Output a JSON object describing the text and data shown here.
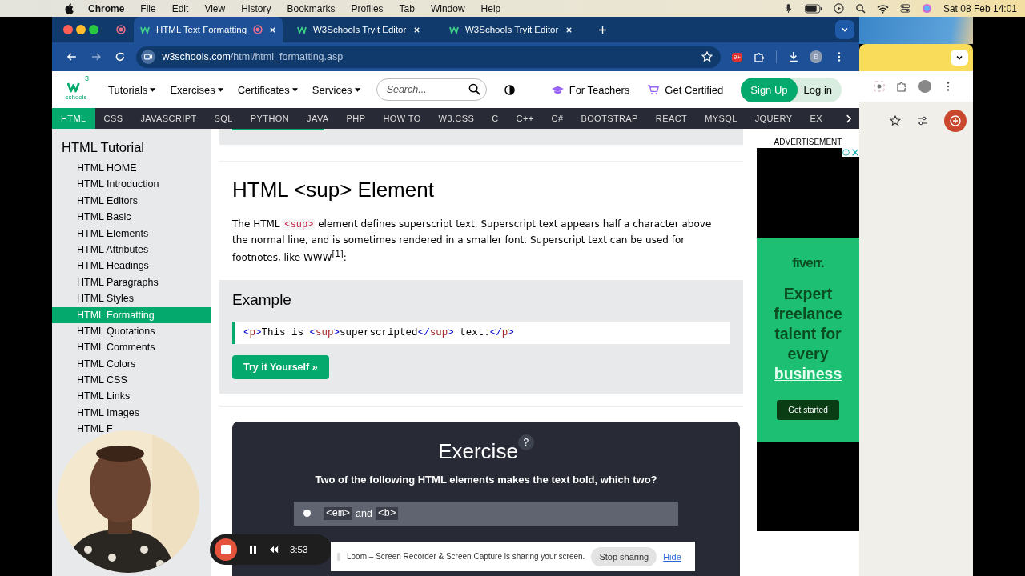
{
  "menu_bar": {
    "app": "Chrome",
    "items": [
      "File",
      "Edit",
      "View",
      "History",
      "Bookmarks",
      "Profiles",
      "Tab",
      "Window",
      "Help"
    ],
    "clock": "Sat 08 Feb  14:01"
  },
  "tabs": [
    {
      "title": "HTML Text Formatting",
      "selected": true
    },
    {
      "title": "W3Schools Tryit Editor",
      "selected": false
    },
    {
      "title": "W3Schools Tryit Editor",
      "selected": false
    }
  ],
  "address_bar": {
    "domain": "w3schools.com",
    "path": "/html/html_formatting.asp",
    "extension_badge": "9+",
    "profile_initial": "B"
  },
  "site_nav": {
    "logo_sup": "3",
    "logo_text": "schools",
    "menus": [
      "Tutorials",
      "Exercises",
      "Certificates",
      "Services"
    ],
    "search_placeholder": "Search...",
    "links": [
      "For Teachers",
      "Get Certified"
    ],
    "sign_up": "Sign Up",
    "log_in": "Log in"
  },
  "topics": [
    {
      "label": "HTML",
      "selected": true
    },
    {
      "label": "CSS",
      "selected": false
    },
    {
      "label": "JAVASCRIPT",
      "selected": false
    },
    {
      "label": "SQL",
      "selected": false
    },
    {
      "label": "PYTHON",
      "selected": false
    },
    {
      "label": "JAVA",
      "selected": false
    },
    {
      "label": "PHP",
      "selected": false
    },
    {
      "label": "HOW TO",
      "selected": false
    },
    {
      "label": "W3.CSS",
      "selected": false
    },
    {
      "label": "C",
      "selected": false
    },
    {
      "label": "C++",
      "selected": false
    },
    {
      "label": "C#",
      "selected": false
    },
    {
      "label": "BOOTSTRAP",
      "selected": false
    },
    {
      "label": "REACT",
      "selected": false
    },
    {
      "label": "MYSQL",
      "selected": false
    },
    {
      "label": "JQUERY",
      "selected": false
    },
    {
      "label": "EX",
      "selected": false
    }
  ],
  "sidebar": {
    "title": "HTML Tutorial",
    "items": [
      {
        "label": "HTML HOME",
        "selected": false
      },
      {
        "label": "HTML Introduction",
        "selected": false
      },
      {
        "label": "HTML Editors",
        "selected": false
      },
      {
        "label": "HTML Basic",
        "selected": false
      },
      {
        "label": "HTML Elements",
        "selected": false
      },
      {
        "label": "HTML Attributes",
        "selected": false
      },
      {
        "label": "HTML Headings",
        "selected": false
      },
      {
        "label": "HTML Paragraphs",
        "selected": false
      },
      {
        "label": "HTML Styles",
        "selected": false
      },
      {
        "label": "HTML Formatting",
        "selected": true
      },
      {
        "label": "HTML Quotations",
        "selected": false
      },
      {
        "label": "HTML Comments",
        "selected": false
      },
      {
        "label": "HTML Colors",
        "selected": false
      },
      {
        "label": "HTML CSS",
        "selected": false
      },
      {
        "label": "HTML Links",
        "selected": false
      },
      {
        "label": "HTML Images",
        "selected": false
      },
      {
        "label": "HTML F",
        "selected": false
      }
    ]
  },
  "article": {
    "heading": "HTML <sup> Element",
    "para_start": "The HTML",
    "para_code": "<sup>",
    "para_rest": "element defines superscript text. Superscript text appears half a character above the normal line, and is sometimes rendered in a smaller font. Superscript text can be used for footnotes, like WWW$^{[1]}$:"
  },
  "example": {
    "title": "Example",
    "code": [
      {
        "kind": "punct",
        "text": "<"
      },
      {
        "kind": "tag",
        "text": "p"
      },
      {
        "kind": "punct",
        "text": ">"
      },
      {
        "kind": "text",
        "text": "This is "
      },
      {
        "kind": "punct",
        "text": "<"
      },
      {
        "kind": "tag",
        "text": "sup"
      },
      {
        "kind": "punct",
        "text": ">"
      },
      {
        "kind": "text",
        "text": "superscripted"
      },
      {
        "kind": "punct",
        "text": "</"
      },
      {
        "kind": "tag",
        "text": "sup"
      },
      {
        "kind": "punct",
        "text": ">"
      },
      {
        "kind": "text",
        "text": " text."
      },
      {
        "kind": "punct",
        "text": "</"
      },
      {
        "kind": "tag",
        "text": "p"
      },
      {
        "kind": "punct",
        "text": ">"
      }
    ],
    "button": "Try it Yourself »"
  },
  "exercise": {
    "title": "Exercise",
    "help": "?",
    "question": "Two of the following HTML elements makes the text bold, which two?",
    "option": {
      "code_a": "<em>",
      "joiner": "and",
      "code_b": "<b>"
    }
  },
  "ad": {
    "label": "ADVERTISEMENT",
    "brand": "fiverr.",
    "headline": "Expert freelance talent for every",
    "link": "business",
    "cta": "Get started"
  },
  "recorder": {
    "time": "3:53"
  },
  "share_notice": {
    "message": "Loom – Screen Recorder & Screen Capture is sharing your screen.",
    "stop": "Stop sharing",
    "hide": "Hide"
  }
}
